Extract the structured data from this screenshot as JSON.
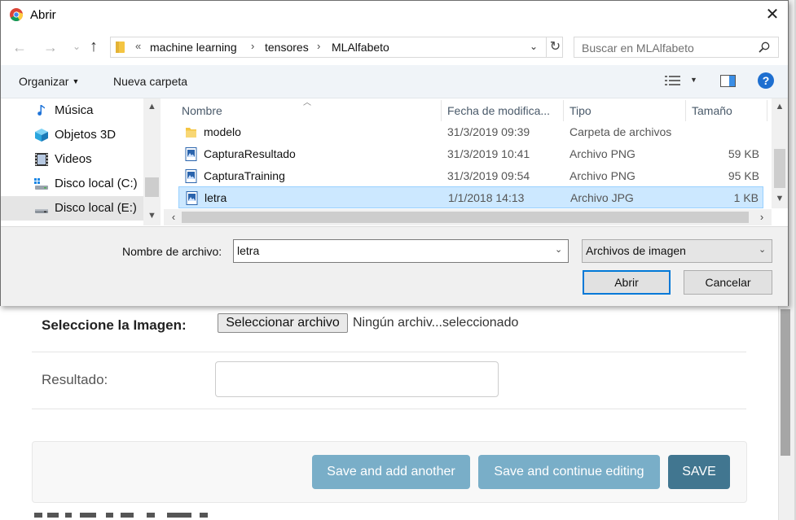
{
  "dialog": {
    "title": "Abrir",
    "close_glyph": "✕",
    "nav": {
      "back_glyph": "←",
      "forward_glyph": "→",
      "recent_glyph": "⌄",
      "up_glyph": "↑",
      "breadcrumb_overflow": "«",
      "breadcrumbs": [
        "machine learning",
        "tensores",
        "MLAlfabeto"
      ],
      "crumb_separator": "›",
      "dropdown_glyph": "⌄",
      "refresh_glyph": "↻",
      "search_placeholder": "Buscar en MLAlfabeto"
    },
    "toolbar": {
      "organize_label": "Organizar",
      "new_folder_label": "Nueva carpeta",
      "help_glyph": "?"
    },
    "nav_pane": {
      "items": [
        {
          "label": "Música",
          "icon": "music-icon"
        },
        {
          "label": "Objetos 3D",
          "icon": "objects-3d-icon"
        },
        {
          "label": "Videos",
          "icon": "video-icon"
        },
        {
          "label": "Disco local (C:)",
          "icon": "drive-c-icon"
        },
        {
          "label": "Disco local (E:)",
          "icon": "drive-e-icon",
          "selected": true
        }
      ]
    },
    "file_list": {
      "columns": [
        "Nombre",
        "Fecha de modifica...",
        "Tipo",
        "Tamaño"
      ],
      "rows": [
        {
          "name": "modelo",
          "date": "31/3/2019 09:39",
          "type": "Carpeta de archivos",
          "size": "",
          "icon": "folder-icon"
        },
        {
          "name": "CapturaResultado",
          "date": "31/3/2019 10:41",
          "type": "Archivo PNG",
          "size": "59 KB",
          "icon": "image-file-icon"
        },
        {
          "name": "CapturaTraining",
          "date": "31/3/2019 09:54",
          "type": "Archivo PNG",
          "size": "95 KB",
          "icon": "image-file-icon"
        },
        {
          "name": "letra",
          "date": "1/1/2018 14:13",
          "type": "Archivo JPG",
          "size": "1 KB",
          "icon": "image-file-icon",
          "selected": true
        }
      ]
    },
    "bottom": {
      "filename_label": "Nombre de archivo:",
      "filename_value": "letra",
      "filetype_value": "Archivos de imagen",
      "open_label": "Abrir",
      "cancel_label": "Cancelar"
    },
    "colors": {
      "selection_bg": "#cce8ff",
      "selection_border": "#99d1ff",
      "primary_border": "#0078d7"
    }
  },
  "form": {
    "image_label": "Seleccione la Imagen:",
    "file_button_label": "Seleccionar archivo",
    "file_status": "Ningún archiv...seleccionado",
    "result_label": "Resultado:",
    "result_value": "",
    "buttons": {
      "save_add": "Save and add another",
      "save_continue": "Save and continue editing",
      "save": "SAVE"
    },
    "colors": {
      "secondary_button": "#79aec8",
      "primary_button": "#417690"
    }
  }
}
